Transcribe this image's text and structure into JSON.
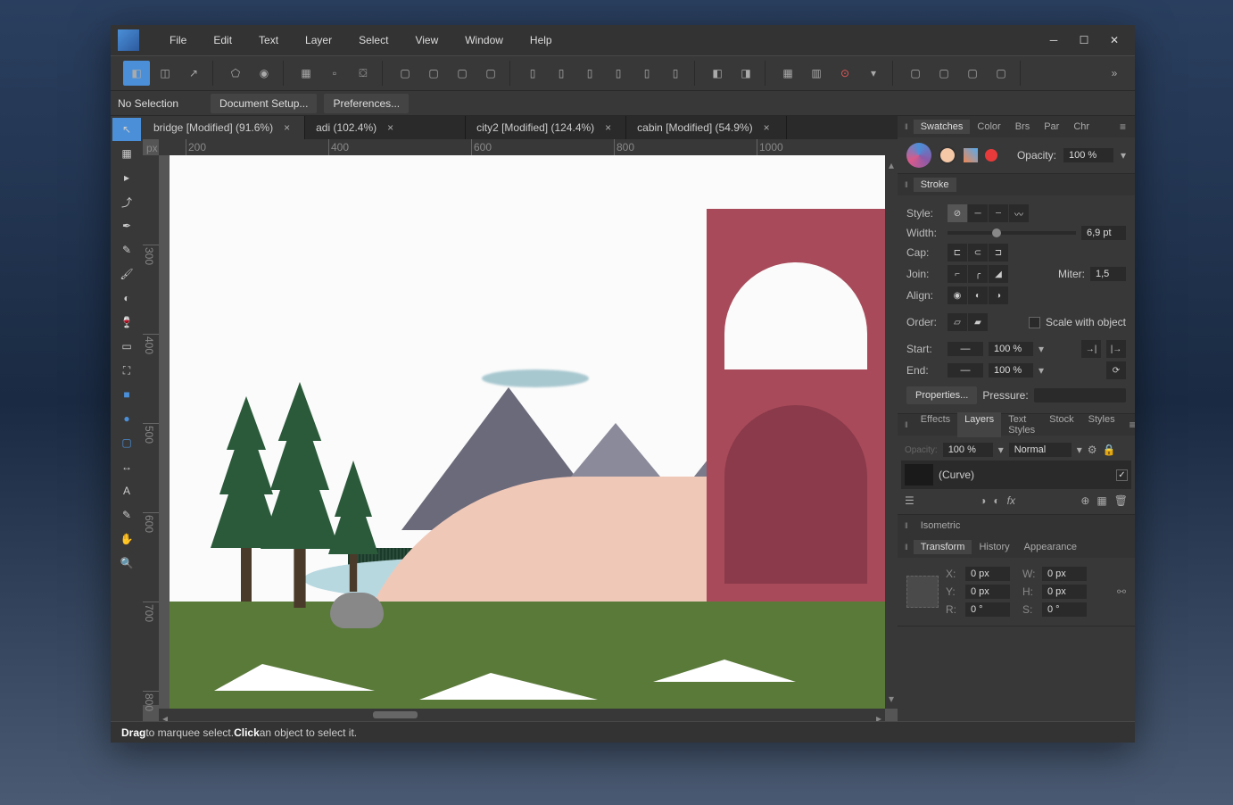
{
  "menu": [
    "File",
    "Edit",
    "Text",
    "Layer",
    "Select",
    "View",
    "Window",
    "Help"
  ],
  "context": {
    "selection": "No Selection",
    "setup": "Document Setup...",
    "prefs": "Preferences..."
  },
  "tabs": [
    {
      "label": "bridge [Modified] (91.6%)",
      "active": true
    },
    {
      "label": "adi (102.4%)",
      "active": false
    },
    {
      "label": "city2 [Modified] (124.4%)",
      "active": false
    },
    {
      "label": "cabin [Modified] (54.9%)",
      "active": false
    }
  ],
  "ruler_unit": "px",
  "ruler_h": [
    "200",
    "400",
    "600",
    "800",
    "1000"
  ],
  "ruler_v": [
    "300",
    "400",
    "500",
    "600",
    "700",
    "800"
  ],
  "right_tabs_top": [
    "Swatches",
    "Color",
    "Brs",
    "Par",
    "Chr"
  ],
  "swatches": {
    "opacity_label": "Opacity:",
    "opacity_val": "100 %"
  },
  "stroke": {
    "title": "Stroke",
    "style_label": "Style:",
    "width_label": "Width:",
    "width_val": "6,9 pt",
    "cap_label": "Cap:",
    "join_label": "Join:",
    "miter_label": "Miter:",
    "miter_val": "1,5",
    "align_label": "Align:",
    "order_label": "Order:",
    "scale_label": "Scale with object",
    "start_label": "Start:",
    "start_pct": "100 %",
    "end_label": "End:",
    "end_pct": "100 %",
    "properties": "Properties...",
    "pressure": "Pressure:"
  },
  "mid_tabs": [
    "Effects",
    "Layers",
    "Text Styles",
    "Stock",
    "Styles"
  ],
  "layers": {
    "opacity_label": "Opacity:",
    "opacity_val": "100 %",
    "blend": "Normal",
    "layer_name": "(Curve)"
  },
  "iso": "Isometric",
  "bottom_tabs": [
    "Transform",
    "History",
    "Appearance"
  ],
  "transform": {
    "x_label": "X:",
    "x": "0 px",
    "y_label": "Y:",
    "y": "0 px",
    "w_label": "W:",
    "w": "0 px",
    "h_label": "H:",
    "h": "0 px",
    "r_label": "R:",
    "r": "0 °",
    "s_label": "S:",
    "s": "0 °"
  },
  "status": {
    "drag": "Drag",
    "drag_txt": " to marquee select. ",
    "click": "Click",
    "click_txt": " an object to select it."
  }
}
